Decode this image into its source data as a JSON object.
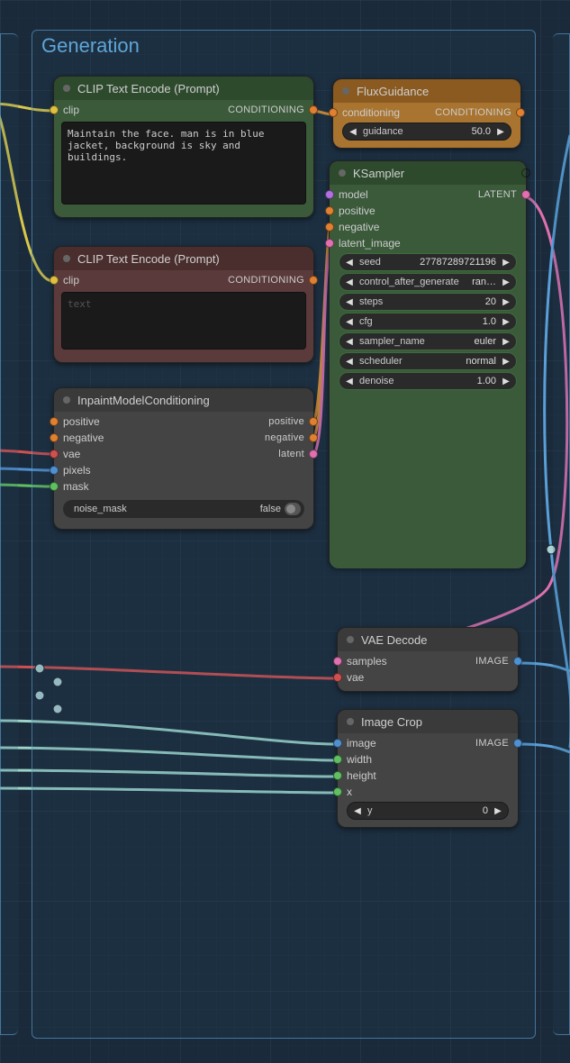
{
  "group": {
    "title": "Generation"
  },
  "clip_pos": {
    "title": "CLIP Text Encode (Prompt)",
    "input_clip": "clip",
    "output_label": "CONDITIONING",
    "text": "Maintain the face. man is in blue jacket, background is sky and buildings."
  },
  "clip_neg": {
    "title": "CLIP Text Encode (Prompt)",
    "input_clip": "clip",
    "output_label": "CONDITIONING",
    "placeholder": "text"
  },
  "inpaint": {
    "title": "InpaintModelConditioning",
    "in_positive": "positive",
    "in_negative": "negative",
    "in_vae": "vae",
    "in_pixels": "pixels",
    "in_mask": "mask",
    "out_positive": "positive",
    "out_negative": "negative",
    "out_latent": "latent",
    "noise_mask_label": "noise_mask",
    "noise_mask_value": "false"
  },
  "flux": {
    "title": "FluxGuidance",
    "in_conditioning": "conditioning",
    "out_label": "CONDITIONING",
    "guidance_label": "guidance",
    "guidance_value": "50.0"
  },
  "ksampler": {
    "title": "KSampler",
    "in_model": "model",
    "in_positive": "positive",
    "in_negative": "negative",
    "in_latent": "latent_image",
    "out_label": "LATENT",
    "seed_label": "seed",
    "seed_value": "27787289721196",
    "cag_label": "control_after_generate",
    "cag_value": "ran…",
    "steps_label": "steps",
    "steps_value": "20",
    "cfg_label": "cfg",
    "cfg_value": "1.0",
    "sampler_label": "sampler_name",
    "sampler_value": "euler",
    "scheduler_label": "scheduler",
    "scheduler_value": "normal",
    "denoise_label": "denoise",
    "denoise_value": "1.00"
  },
  "vae": {
    "title": "VAE Decode",
    "in_samples": "samples",
    "in_vae": "vae",
    "out_label": "IMAGE"
  },
  "crop": {
    "title": "Image Crop",
    "in_image": "image",
    "in_width": "width",
    "in_height": "height",
    "in_x": "x",
    "out_label": "IMAGE",
    "y_label": "y",
    "y_value": "0"
  }
}
